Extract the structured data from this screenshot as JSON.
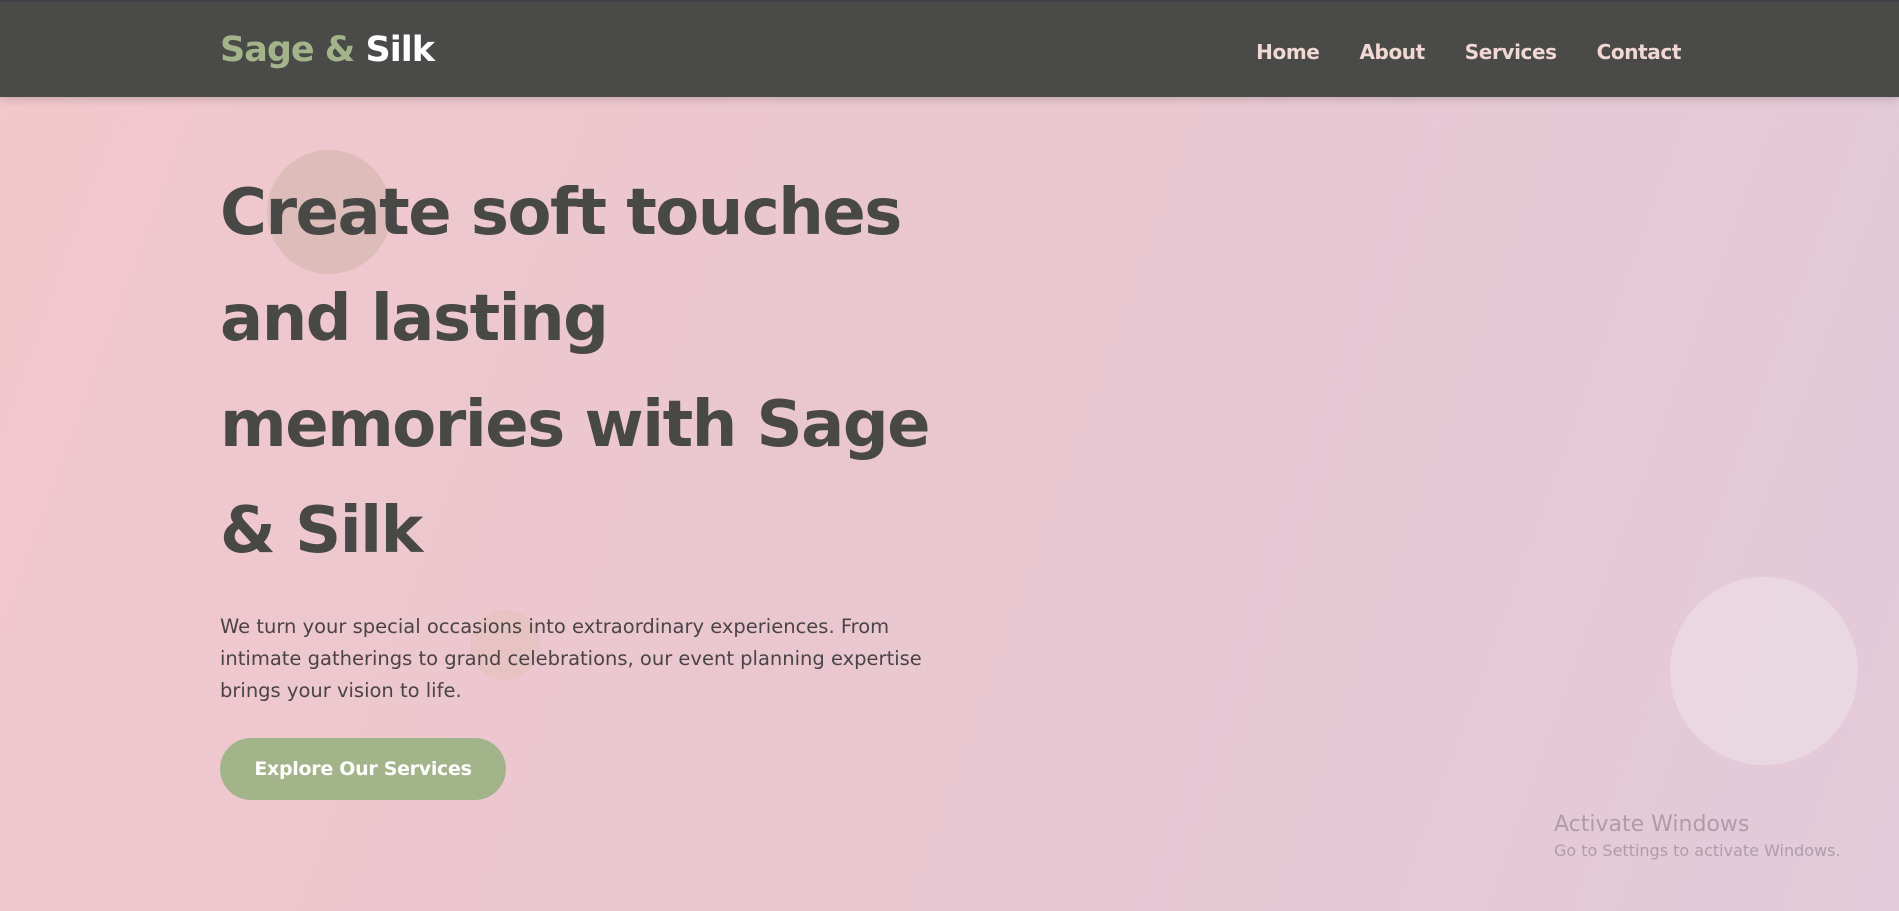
{
  "header": {
    "logo_part1": "Sage &",
    "logo_part2": "Silk",
    "nav": {
      "home": "Home",
      "about": "About",
      "services": "Services",
      "contact": "Contact"
    }
  },
  "hero": {
    "title": "Create soft touches and lasting memories with Sage & Silk",
    "description": "We turn your special occasions into extraordinary experiences. From intimate gatherings to grand celebrations, our event planning expertise brings your vision to life.",
    "cta_label": "Explore Our Services"
  },
  "watermark": {
    "title": "Activate Windows",
    "subtitle": "Go to Settings to activate Windows."
  },
  "colors": {
    "header_bg": "#4a4a48",
    "accent_sage": "#a3b48a",
    "heading_text": "#484846",
    "background_start": "#f1c8cc",
    "background_end": "#e3cbd9"
  }
}
